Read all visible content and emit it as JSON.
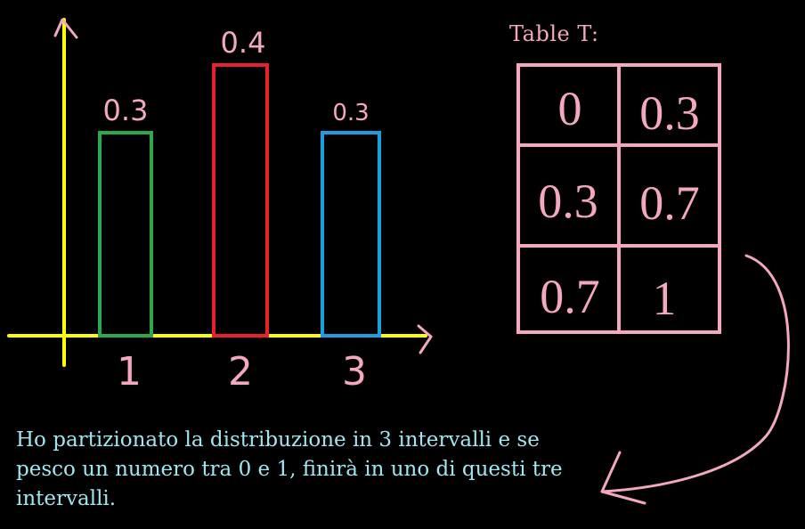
{
  "colors": {
    "background": "#000000",
    "axis": "#ffff00",
    "pink": "#f4a7c0",
    "caption": "#9fe7f0"
  },
  "chart_data": {
    "type": "bar",
    "categories": [
      "1",
      "2",
      "3"
    ],
    "values": [
      0.3,
      0.4,
      0.3
    ],
    "data_labels": [
      "0.3",
      "0.4",
      "0.3"
    ],
    "bar_colors": [
      "#2aa84a",
      "#e8212b",
      "#1aa0e0"
    ],
    "axis_color": "#ffff00",
    "ylim": [
      0,
      0.5
    ],
    "grid": false,
    "title": "",
    "xlabel": "",
    "ylabel": ""
  },
  "table": {
    "title": "Table T:",
    "rows": [
      [
        "0",
        "0.3"
      ],
      [
        "0.3",
        "0.7"
      ],
      [
        "0.7",
        "1"
      ]
    ]
  },
  "caption": "Ho partizionato la distribuzione in 3 intervalli e se pesco un numero tra 0 e 1, finirà in uno di questi tre intervalli.",
  "arrow": {
    "icon": "curved-arrow-icon",
    "color": "#f4a7c0"
  }
}
